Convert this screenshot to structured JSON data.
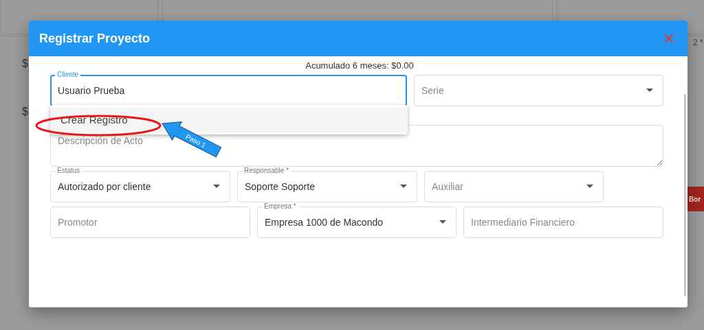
{
  "background": {
    "amounts": [
      "$",
      "$"
    ],
    "column_label": "2 *",
    "button": "Bor"
  },
  "dialog": {
    "title": "Registrar Proyecto",
    "summary": "Acumulado 6 meses: $0.00",
    "rows": [
      [
        {
          "kind": "text",
          "label": "Cliente",
          "value": "Usuario Prueba",
          "focused": true
        },
        {
          "kind": "select",
          "placeholder": "Serie",
          "focused": false
        }
      ],
      [
        {
          "kind": "textarea",
          "placeholder": "Descripción de Acto",
          "focused": false
        }
      ],
      [
        {
          "kind": "select",
          "label": "Estatus",
          "value": "Autorizado por cliente",
          "focused": false
        },
        {
          "kind": "select",
          "label": "Responsable *",
          "value": "Soporte Soporte",
          "focused": false
        },
        {
          "kind": "select",
          "placeholder": "Auxiliar",
          "focused": false
        }
      ],
      [
        {
          "kind": "text",
          "placeholder": "Promotor",
          "focused": false
        },
        {
          "kind": "select",
          "label": "Empresa *",
          "value": "Empresa 1000 de Macondo",
          "focused": false
        },
        {
          "kind": "text",
          "placeholder": "Intermediario Financiero",
          "focused": false
        }
      ]
    ],
    "autocomplete": {
      "options": [
        {
          "label": "Crear Registro"
        }
      ]
    }
  },
  "annotation": {
    "label": "Paso 1"
  }
}
